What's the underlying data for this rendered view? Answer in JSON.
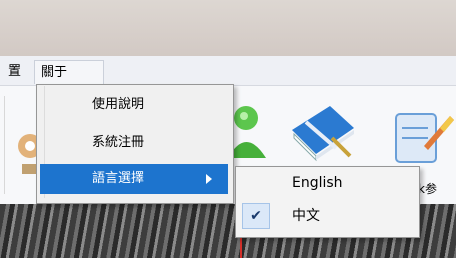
{
  "menubar": {
    "settings_label": "置",
    "about_label": "關于"
  },
  "about_menu": {
    "items": [
      {
        "label": "使用說明"
      },
      {
        "label": "系統注冊"
      },
      {
        "label": "語言選擇"
      }
    ]
  },
  "language_submenu": {
    "items": [
      {
        "label": "English",
        "checked": false
      },
      {
        "label": "中文",
        "checked": true
      }
    ],
    "check_glyph": "✔"
  },
  "toolbar": {
    "partial_label": "k参",
    "icons": [
      "gear-icon",
      "users-icon",
      "book-icon",
      "edit-document-icon"
    ]
  },
  "colors": {
    "highlight": "#1d74ce",
    "menu_background": "#f0f0f0"
  }
}
